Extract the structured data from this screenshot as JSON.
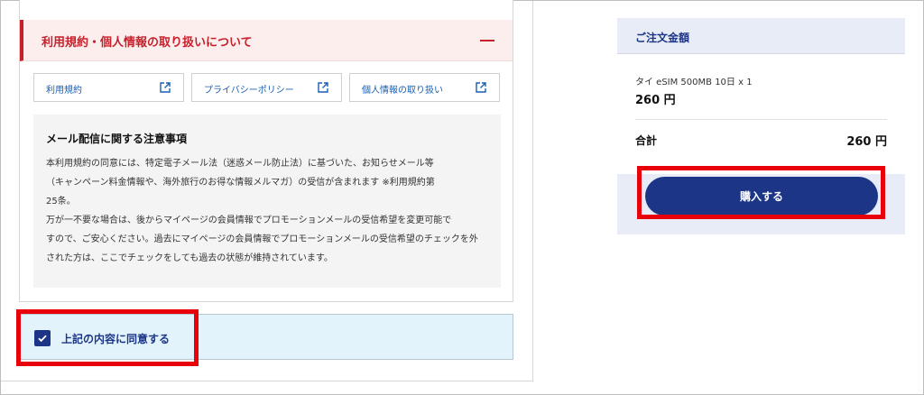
{
  "terms": {
    "title": "利用規約・個人情報の取り扱いについて",
    "links": [
      {
        "label": "利用規約"
      },
      {
        "label": "プライバシーポリシー"
      },
      {
        "label": "個人情報の取り扱い"
      }
    ]
  },
  "notice": {
    "title": "メール配信に関する注意事項",
    "lines": [
      "本利用規約の同意には、特定電子メール法（迷惑メール防止法）に基づいた、お知らせメール等",
      "（キャンペーン料金情報や、海外旅行のお得な情報メルマガ）の受信が含まれます ※利用規約第",
      "25条。",
      "万が一不要な場合は、後からマイページの会員情報でプロモーションメールの受信希望を変更可能で",
      "すので、ご安心ください。過去にマイページの会員情報でプロモーションメールの受信希望のチェックを外",
      "された方は、ここでチェックをしても過去の状態が維持されています。"
    ]
  },
  "agree": {
    "label": "上記の内容に同意する",
    "checked": true
  },
  "order": {
    "title": "ご注文金額",
    "item_name": "タイ eSIM 500MB 10日 x 1",
    "item_price": "260 円",
    "total_label": "合計",
    "total_value": "260 円",
    "buy_label": "購入する"
  },
  "colors": {
    "brand_navy": "#1c3587",
    "alert_red": "#c8202a",
    "highlight_red": "#e8000b",
    "link_blue": "#1a5fb4"
  }
}
